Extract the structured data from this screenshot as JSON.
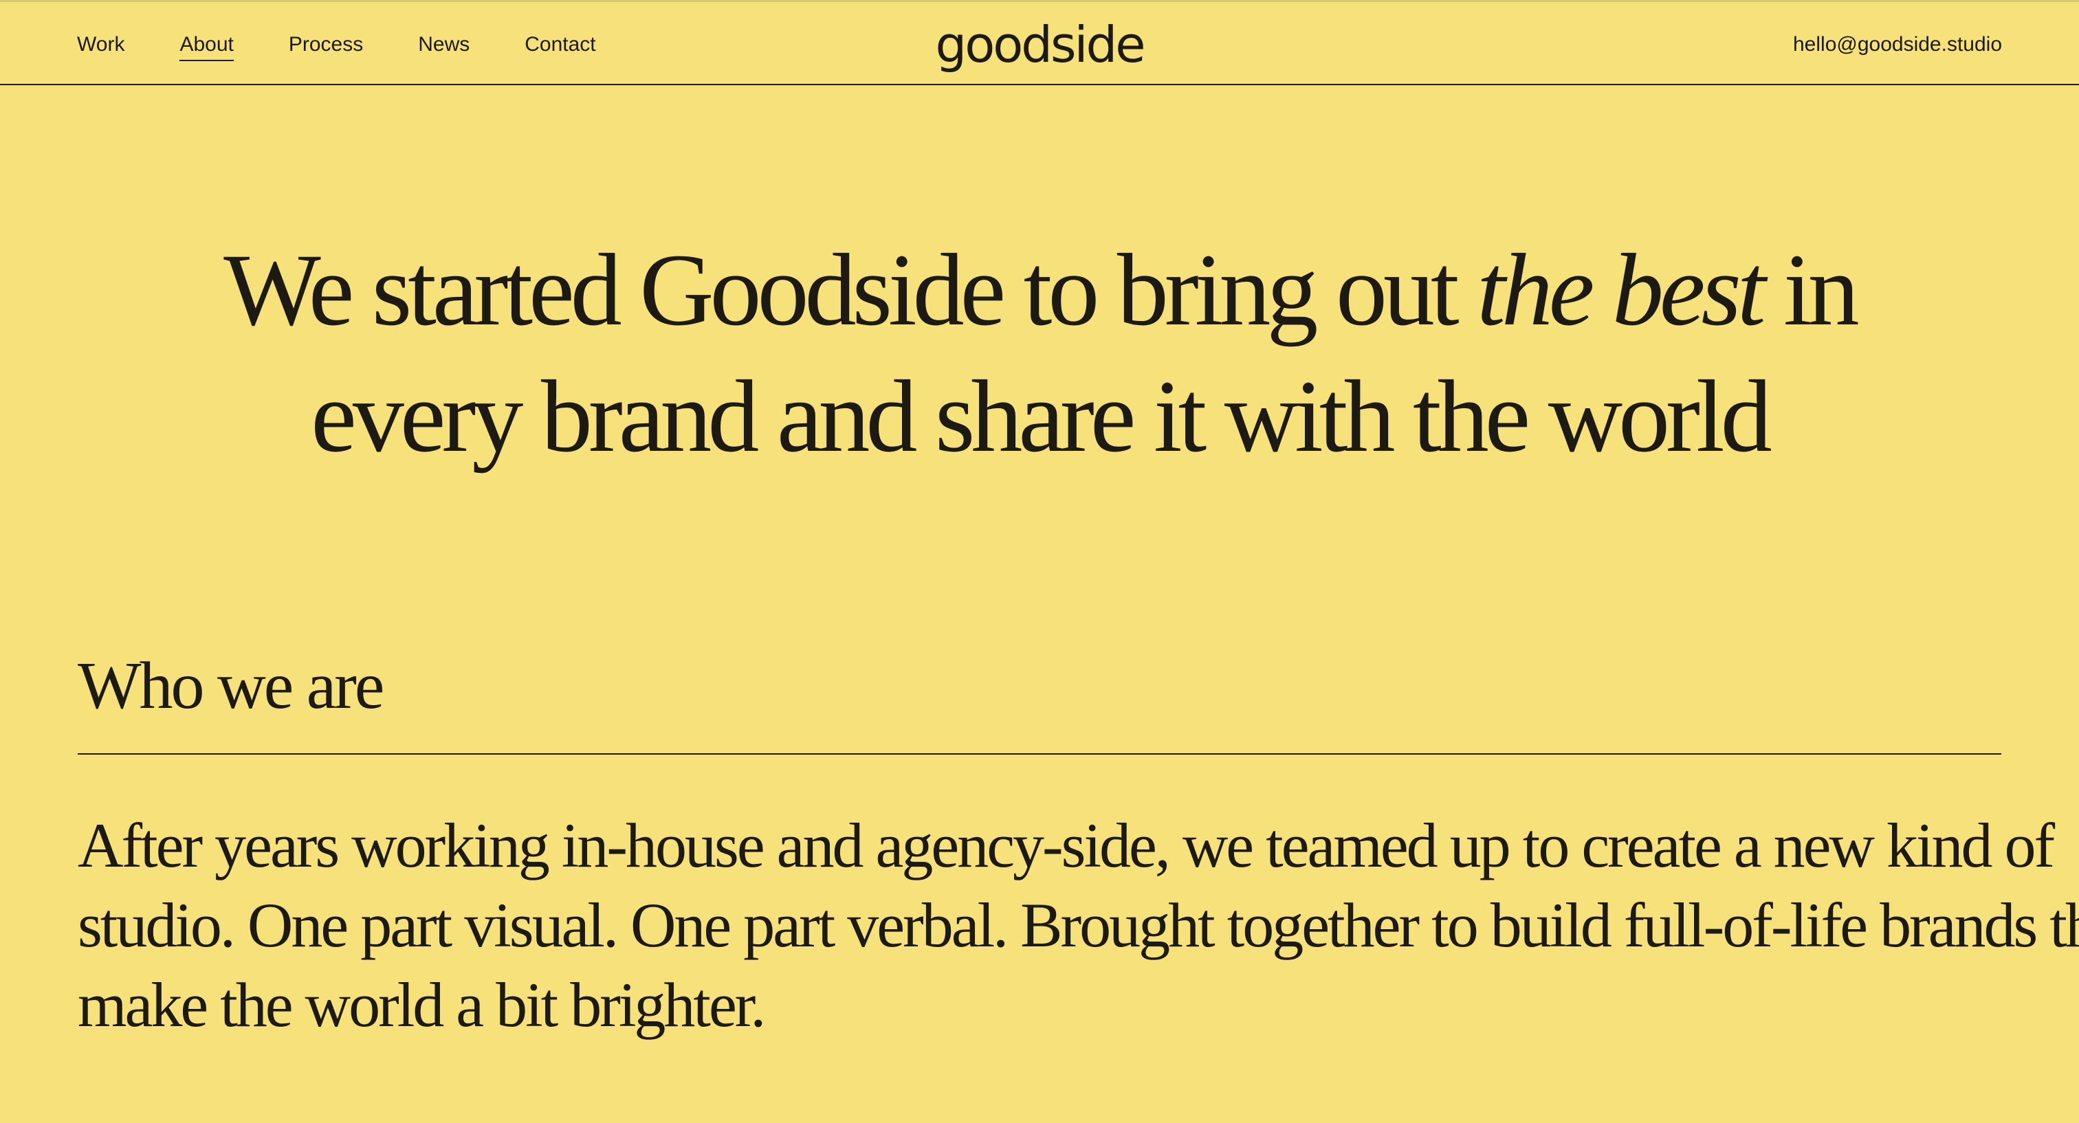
{
  "nav": {
    "items": [
      {
        "label": "Work",
        "active": false
      },
      {
        "label": "About",
        "active": true
      },
      {
        "label": "Process",
        "active": false
      },
      {
        "label": "News",
        "active": false
      },
      {
        "label": "Contact",
        "active": false
      }
    ]
  },
  "brand": {
    "logo_text": "goodside"
  },
  "header": {
    "email": "hello@goodside.studio"
  },
  "hero": {
    "line1_start": "We started Goodside to bring out ",
    "line1_emphasis": "the best",
    "line1_end": " in",
    "line2": "every brand and share it with the world"
  },
  "section": {
    "title": "Who we are",
    "body_lines": [
      "After years working in-house and agency-side, we teamed up to create a new kind of",
      "studio. One part visual. One part verbal. Brought together to build full-of-life brands that",
      "make the world a bit brighter."
    ]
  },
  "colors": {
    "background": "#f7e17b",
    "text": "#1d1a14"
  }
}
